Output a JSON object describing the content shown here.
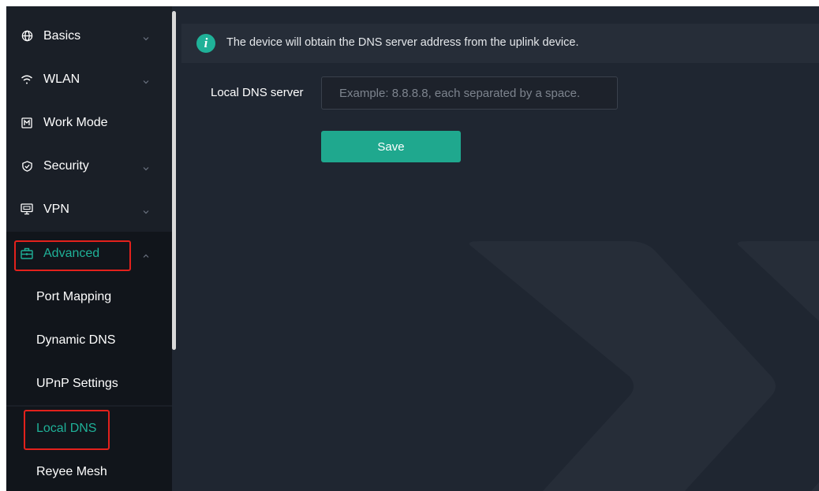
{
  "sidebar": {
    "items": [
      {
        "label": "Basics",
        "icon": "globe-icon",
        "expandable": true
      },
      {
        "label": "WLAN",
        "icon": "wifi-icon",
        "expandable": true
      },
      {
        "label": "Work Mode",
        "icon": "work-mode-icon",
        "expandable": false
      },
      {
        "label": "Security",
        "icon": "shield-icon",
        "expandable": true
      },
      {
        "label": "VPN",
        "icon": "vpn-icon",
        "expandable": true
      },
      {
        "label": "Advanced",
        "icon": "toolbox-icon",
        "expandable": true,
        "expanded": true
      }
    ],
    "subitems": [
      {
        "label": "Port Mapping"
      },
      {
        "label": "Dynamic DNS"
      },
      {
        "label": "UPnP Settings"
      },
      {
        "label": "Local DNS",
        "active": true
      },
      {
        "label": "Reyee Mesh"
      }
    ]
  },
  "main": {
    "info_text": "The device will obtain the DNS server address from the uplink device.",
    "info_icon": "i",
    "field_label": "Local DNS server",
    "input_placeholder": "Example: 8.8.8.8, each separated by a space.",
    "input_value": "",
    "save_label": "Save"
  },
  "colors": {
    "accent": "#1fb198",
    "highlight_box": "#e3211c",
    "background": "#1f2631",
    "sidebar": "#1a1f27"
  }
}
